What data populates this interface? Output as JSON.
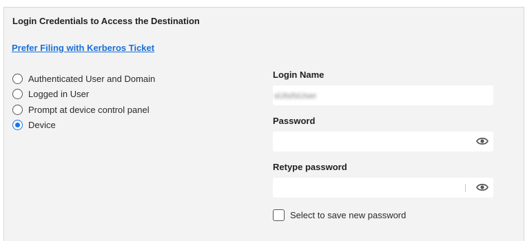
{
  "section": {
    "title": "Login Credentials to Access the Destination",
    "kerberos_link": "Prefer Filing with Kerberos Ticket"
  },
  "auth_options": {
    "selected": "Device",
    "items": [
      {
        "label": "Authenticated User and Domain",
        "checked": false
      },
      {
        "label": "Logged in User",
        "checked": false
      },
      {
        "label": "Prompt at device control panel",
        "checked": false
      },
      {
        "label": "Device",
        "checked": true
      }
    ]
  },
  "fields": {
    "login_name": {
      "label": "Login Name",
      "value": "sUtsfsUser",
      "value_obscured": true
    },
    "password": {
      "label": "Password",
      "value": "",
      "icon": "eye-icon"
    },
    "retype_password": {
      "label": "Retype password",
      "value": "",
      "icon": "eye-icon"
    }
  },
  "save_password": {
    "label": "Select to save new password",
    "checked": false
  },
  "colors": {
    "accent": "#1a73e8",
    "link": "#1a6fd6",
    "panel_bg": "#f3f3f3",
    "field_bg": "#ffffff"
  }
}
